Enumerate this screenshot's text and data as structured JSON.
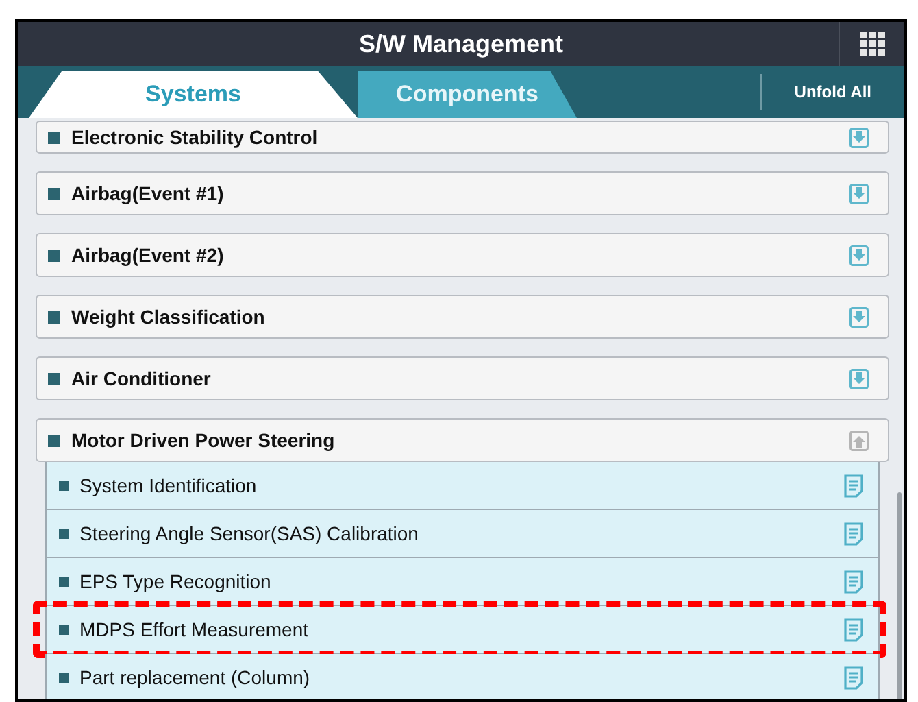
{
  "window": {
    "title": "S/W Management"
  },
  "tabs": [
    {
      "label": "Systems",
      "selected": true
    },
    {
      "label": "Components",
      "selected": false
    }
  ],
  "unfold_button": {
    "label": "Unfold All"
  },
  "groups": [
    {
      "name": "Electronic Stability Control",
      "expanded": false
    },
    {
      "name": "Airbag(Event #1)",
      "expanded": false
    },
    {
      "name": "Airbag(Event #2)",
      "expanded": false
    },
    {
      "name": "Weight Classification",
      "expanded": false
    },
    {
      "name": "Air Conditioner",
      "expanded": false
    },
    {
      "name": "Motor Driven Power Steering",
      "expanded": true,
      "children": [
        {
          "name": "System Identification",
          "highlighted": false
        },
        {
          "name": "Steering Angle Sensor(SAS) Calibration",
          "highlighted": false
        },
        {
          "name": "EPS Type Recognition",
          "highlighted": false
        },
        {
          "name": "MDPS Effort Measurement",
          "highlighted": true
        },
        {
          "name": "Part replacement (Column)",
          "highlighted": false
        }
      ]
    }
  ]
}
